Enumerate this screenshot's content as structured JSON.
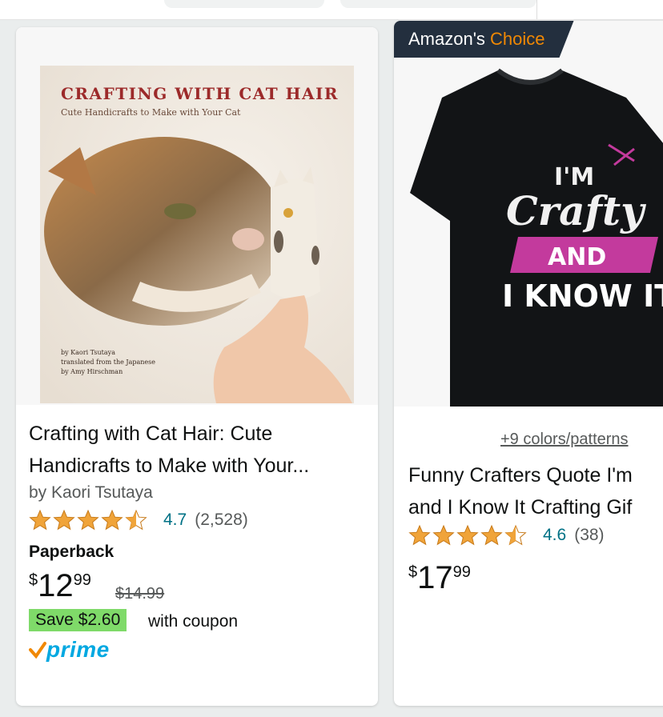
{
  "colors": {
    "star": "#f0a43a",
    "accent_orange": "#f08804",
    "link": "#007185",
    "save_badge": "#7fda69",
    "prime": "#00a8e1",
    "badge_bg": "#232f3e"
  },
  "product1": {
    "cover": {
      "title": "CRAFTING WITH CAT HAIR",
      "subtitle": "Cute Handicrafts to Make with Your Cat",
      "credit_1": "by Kaori Tsutaya",
      "credit_2": "translated from the Japanese",
      "credit_3": "by Amy Hirschman"
    },
    "title_line1": "Crafting with Cat Hair: Cute",
    "title_line2": "Handicrafts to Make with Your...",
    "author": "by Kaori Tsutaya",
    "rating": "4.7",
    "rating_value": 4.7,
    "review_count": "(2,528)",
    "format": "Paperback",
    "price_symbol": "$",
    "price_whole": "12",
    "price_fraction": "99",
    "list_price": "$14.99",
    "coupon_label": "Save $2.60",
    "coupon_suffix": "with coupon",
    "prime_label": "prime",
    "prime_icon": "check-icon"
  },
  "product2": {
    "badge_part1": "Amazon's",
    "badge_part2": "Choice",
    "shirt_text": {
      "line1": "I'M",
      "line2": "Crafty",
      "line3": "AND",
      "line4": "I KNOW IT"
    },
    "colors_link": "+9 colors/patterns",
    "title_line1": "Funny Crafters Quote I'm",
    "title_line2": "and I Know It Crafting Gif",
    "rating": "4.6",
    "rating_value": 4.6,
    "review_count": "(38)",
    "price_symbol": "$",
    "price_whole": "17",
    "price_fraction": "99"
  }
}
